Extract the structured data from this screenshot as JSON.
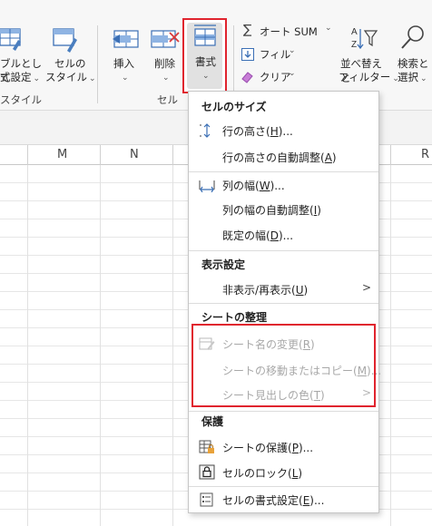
{
  "ribbon": {
    "table_format_label_1": "ブルとして",
    "table_format_label_2": "式設定",
    "cell_style_label_1": "セルの",
    "cell_style_label_2": "スタイル",
    "styles_group": "スタイル",
    "insert_label": "挿入",
    "delete_label": "削除",
    "format_label": "書式",
    "cells_group": "セル",
    "autosum_label": "オート SUM",
    "fill_label": "フィル",
    "clear_label": "クリア",
    "sort_filter_label_1": "並べ替えと",
    "sort_filter_label_2": "フィルター",
    "find_select_label_1": "検索と",
    "find_select_label_2": "選択"
  },
  "sheet": {
    "columns": [
      "M",
      "N",
      "R"
    ]
  },
  "menu": {
    "section_cell_size": "セルのサイズ",
    "row_height": {
      "text": "行の高さ(",
      "key": "H",
      "tail": ")..."
    },
    "autofit_row": {
      "text": "行の高さの自動調整(",
      "key": "A",
      "tail": ")"
    },
    "column_width": {
      "text": "列の幅(",
      "key": "W",
      "tail": ")..."
    },
    "autofit_column": {
      "text": "列の幅の自動調整(",
      "key": "I",
      "tail": ")"
    },
    "default_width": {
      "text": "既定の幅(",
      "key": "D",
      "tail": ")..."
    },
    "section_visibility": "表示設定",
    "hide_unhide": {
      "text": "非表示/再表示(",
      "key": "U",
      "tail": ")"
    },
    "section_organize": "シートの整理",
    "rename_sheet": {
      "text": "シート名の変更(",
      "key": "R",
      "tail": ")"
    },
    "move_copy_sheet": {
      "text": "シートの移動またはコピー(",
      "key": "M",
      "tail": ")..."
    },
    "tab_color": {
      "text": "シート見出しの色(",
      "key": "T",
      "tail": ")"
    },
    "section_protection": "保護",
    "protect_sheet": {
      "text": "シートの保護(",
      "key": "P",
      "tail": ")..."
    },
    "lock_cell": {
      "text": "セルのロック(",
      "key": "L",
      "tail": ")"
    },
    "format_cells": {
      "text": "セルの書式設定(",
      "key": "E",
      "tail": ")..."
    }
  }
}
